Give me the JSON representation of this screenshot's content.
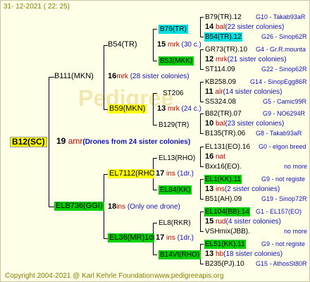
{
  "header": {
    "date": "31- 12-2021 ( 22: 25)"
  },
  "footer": {
    "copyright": "Copyright 2004-2021 @ Karl Kehrle Foundation",
    "url": "www.pedigreeapis.org"
  },
  "root": {
    "name": "B12(SC)",
    "num": "19",
    "kind": "amr",
    "note": "(Drones from 24 sister colonies)"
  },
  "gen1": [
    {
      "name": "B111(MKN)",
      "num": "16",
      "kind": "mrk",
      "note": "(28 sister colonies)"
    },
    {
      "name": "ELB736(GGI)",
      "num": "18",
      "kind": "ins",
      "note": "(Only one drone)"
    }
  ],
  "gen2": [
    {
      "name": "B54(TR)",
      "num": "15",
      "kind": "mrk",
      "note": "(30 c.)"
    },
    {
      "name": "B59(MKN)",
      "num": "13",
      "kind": "mrk",
      "note": "(24 c.)"
    },
    {
      "name": "EL7112(RHO)",
      "num": "17",
      "kind": "ins",
      "note": "(1dr.)"
    },
    {
      "name": "EL36(MR)1dr",
      "num": "17",
      "kind": "ins",
      "note": "(1dr.)"
    }
  ],
  "gen3": [
    {
      "name": "B76(TR)"
    },
    {
      "name": "B53(MKK)"
    },
    {
      "name": "ST206"
    },
    {
      "name": "B129(TR)"
    },
    {
      "name": "EL13(RHO)"
    },
    {
      "name": "EL84(KK)"
    },
    {
      "name": "EL8(RKR)"
    },
    {
      "name": "B14Vt(RHO)"
    }
  ],
  "gen4": [
    {
      "name": "B79(TR).12",
      "right": "G10 - Takab93aR"
    },
    {
      "num": "14",
      "kind": "bal",
      "note": "(22 sister colonies)"
    },
    {
      "name": "B54(TR).12",
      "right": "G26 - Sinop62R"
    },
    {
      "name": "GR73(TR).10",
      "right": "G4 - Gr.R.mounta"
    },
    {
      "num": "12",
      "kind": "mrk",
      "note": "(21 sister colonies)"
    },
    {
      "name": "ST114.09",
      "right": "G22 - Sinop62R"
    },
    {
      "name": "KB258.09",
      "right": "G14 - SinopEgg86R"
    },
    {
      "num": "11",
      "kind": "alr",
      "note": "(14 sister colonies)"
    },
    {
      "name": "SS324.08",
      "right": "G5 - Camic99R"
    },
    {
      "name": "B82(TR).07",
      "right": "G9 - NO6294R"
    },
    {
      "num": "10",
      "kind": "bal",
      "note": "(23 sister colonies)"
    },
    {
      "name": "B135(TR).06",
      "right": "G8 - Takab93aR"
    },
    {
      "name": "EL131(EO).16",
      "right": "G0 - elgon breed"
    },
    {
      "num": "16",
      "kind": "nat",
      "note": ""
    },
    {
      "name": "Bxx16(EO).",
      "right": "no more"
    },
    {
      "name": "EL1(KK).11",
      "right": "G9 - not registe"
    },
    {
      "num": "13",
      "kind": "ins",
      "note": "(2 sister colonies)"
    },
    {
      "name": "B51(AH).09",
      "right": "G19 - Sinop72R"
    },
    {
      "name": "EL104(BB).14",
      "right": "G1 - EL157(EO)"
    },
    {
      "num": "15",
      "kind": "rud",
      "note": "(4 sister colonies)"
    },
    {
      "name": "VSHmix(JBB).",
      "right": "no more"
    },
    {
      "name": "EL51(KK).11",
      "right": "G9 - not registe"
    },
    {
      "num": "13",
      "kind": "hb",
      "note": "(18 sister colonies)"
    },
    {
      "name": "B235(PJ).10",
      "right": "G15 - AthosSt80R"
    }
  ]
}
